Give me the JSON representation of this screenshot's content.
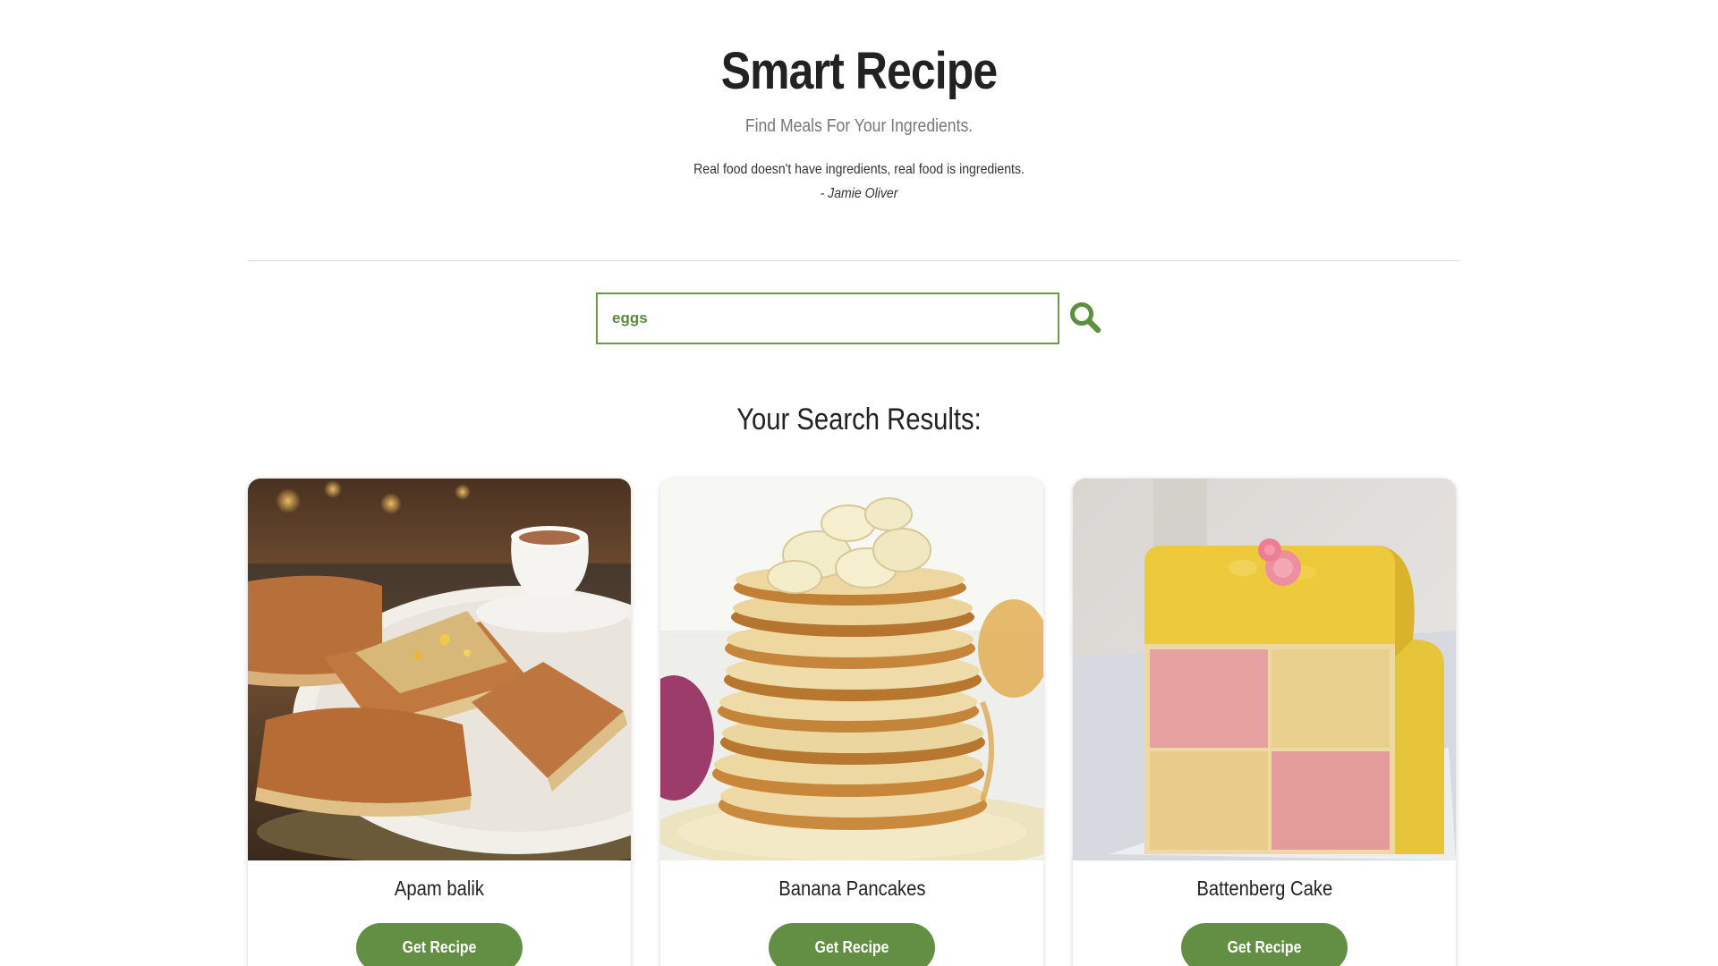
{
  "header": {
    "title": "Smart Recipe",
    "subtitle": "Find Meals For Your Ingredients.",
    "quote": "Real food doesn't have ingredients, real food is ingredients.",
    "quote_author": "- Jamie Oliver"
  },
  "search": {
    "value": "eggs",
    "button_icon": "search-icon"
  },
  "results": {
    "heading": "Your Search Results:",
    "items": [
      {
        "title": "Apam balik",
        "button_label": "Get Recipe",
        "image": "apam-balik-photo"
      },
      {
        "title": "Banana Pancakes",
        "button_label": "Get Recipe",
        "image": "banana-pancakes-photo"
      },
      {
        "title": "Battenberg Cake",
        "button_label": "Get Recipe",
        "image": "battenberg-cake-photo"
      }
    ]
  },
  "colors": {
    "accent": "#638f45",
    "input_border": "#6a9a4a",
    "divider": "#dddddd"
  }
}
